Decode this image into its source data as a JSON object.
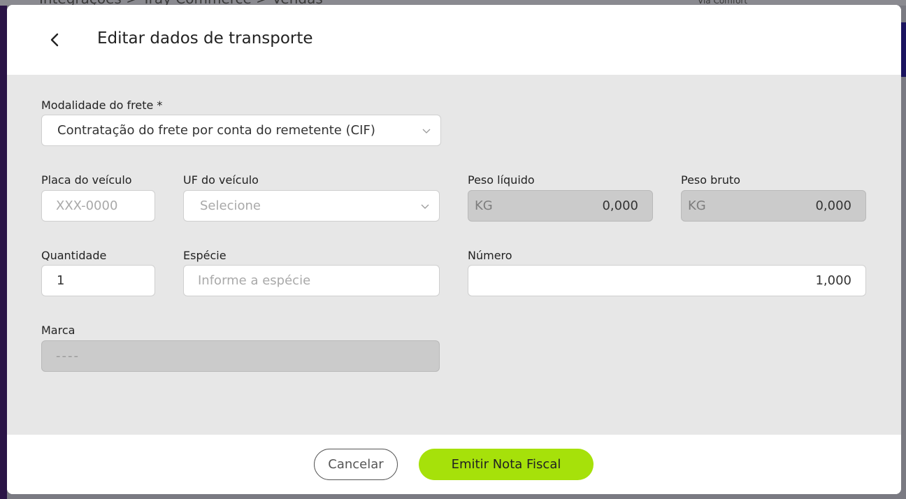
{
  "background": {
    "breadcrumb": "Integrações  >  Tray Commerce  >  Vendas",
    "store_name": "Via Comfort"
  },
  "modal": {
    "title": "Editar dados de transporte",
    "icons": {
      "back": "chevron-left-icon",
      "select_arrow": "chevron-down-icon"
    },
    "fields": {
      "modalidade": {
        "label": "Modalidade do frete *",
        "value": "Contratação do frete por conta do remetente (CIF)"
      },
      "placa": {
        "label": "Placa do veículo",
        "placeholder": "XXX-0000"
      },
      "uf": {
        "label": "UF do veículo",
        "placeholder": "Selecione"
      },
      "peso_liquido": {
        "label": "Peso líquido",
        "unit": "KG",
        "value": "0,000"
      },
      "peso_bruto": {
        "label": "Peso bruto",
        "unit": "KG",
        "value": "0,000"
      },
      "quantidade": {
        "label": "Quantidade",
        "value": "1"
      },
      "especie": {
        "label": "Espécie",
        "placeholder": "Informe a espécie"
      },
      "numero": {
        "label": "Número",
        "value": "1,000"
      },
      "marca": {
        "label": "Marca",
        "value": "----"
      }
    },
    "footer": {
      "cancel_label": "Cancelar",
      "emit_label": "Emitir Nota Fiscal"
    }
  },
  "colors": {
    "primary_button": "#a6e10a",
    "body_background": "#e7e7e7",
    "disabled_field": "#cbcbcb"
  }
}
